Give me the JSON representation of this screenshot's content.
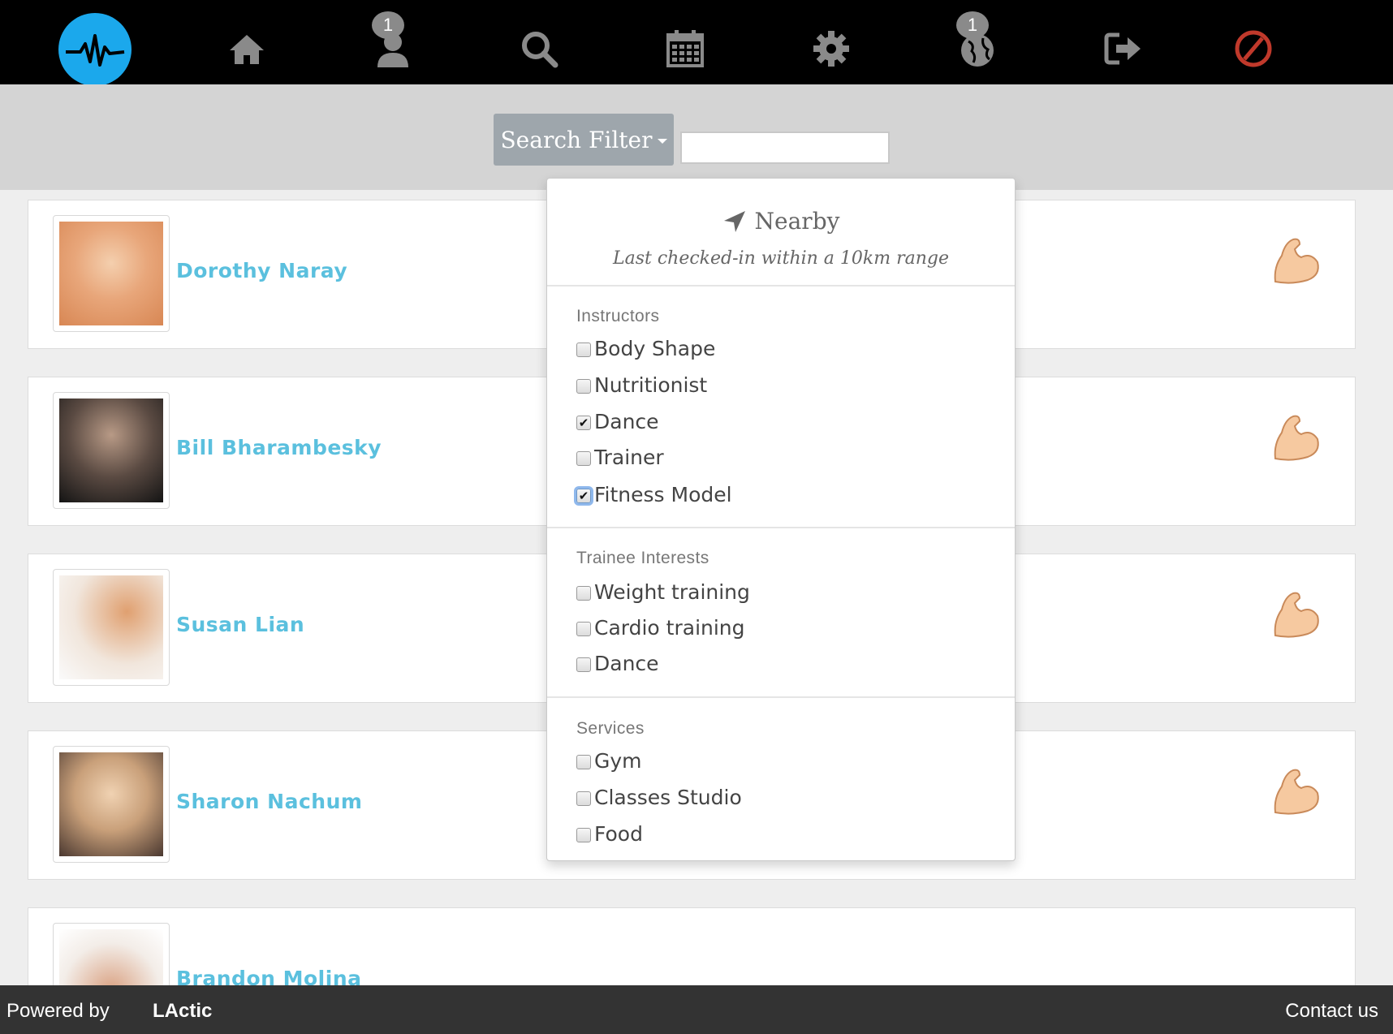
{
  "nav": {
    "logo": "pulse-logo",
    "items": [
      {
        "name": "home",
        "icon": "home-icon"
      },
      {
        "name": "profile",
        "icon": "user-icon",
        "badge": "1"
      },
      {
        "name": "search",
        "icon": "search-icon"
      },
      {
        "name": "calendar",
        "icon": "calendar-icon"
      },
      {
        "name": "settings",
        "icon": "gear-icon"
      },
      {
        "name": "globe",
        "icon": "globe-icon",
        "badge": "1"
      },
      {
        "name": "logout",
        "icon": "logout-icon"
      },
      {
        "name": "block",
        "icon": "no-entry-icon"
      }
    ]
  },
  "search": {
    "filter_label": "Search Filter",
    "input_value": ""
  },
  "people": [
    {
      "name": "Dorothy Naray"
    },
    {
      "name": "Bill Bharambesky"
    },
    {
      "name": "Susan Lian"
    },
    {
      "name": "Sharon Nachum"
    },
    {
      "name": "Brandon Molina"
    }
  ],
  "filter": {
    "nearby_title": "Nearby",
    "nearby_sub": "Last checked-in within a 10km range",
    "instructors_head": "Instructors",
    "instructors": [
      {
        "label": "Body Shape",
        "checked": false
      },
      {
        "label": "Nutritionist",
        "checked": false
      },
      {
        "label": "Dance",
        "checked": true
      },
      {
        "label": "Trainer",
        "checked": false
      },
      {
        "label": "Fitness Model",
        "checked": true
      }
    ],
    "trainee_head": "Trainee Interests",
    "trainee": [
      {
        "label": "Weight training",
        "checked": false
      },
      {
        "label": "Cardio training",
        "checked": false
      },
      {
        "label": "Dance",
        "checked": false
      }
    ],
    "services_head": "Services",
    "services": [
      {
        "label": "Gym",
        "checked": false
      },
      {
        "label": "Classes Studio",
        "checked": false
      },
      {
        "label": "Food",
        "checked": false
      }
    ]
  },
  "footer": {
    "powered": "Powered by",
    "brand": "LActic",
    "contact": "Contact us"
  },
  "colors": {
    "accent": "#5bc0de",
    "logo_bg": "#1ba8ec",
    "nav_bg": "#000000",
    "filter_btn": "#9ea6ac"
  }
}
